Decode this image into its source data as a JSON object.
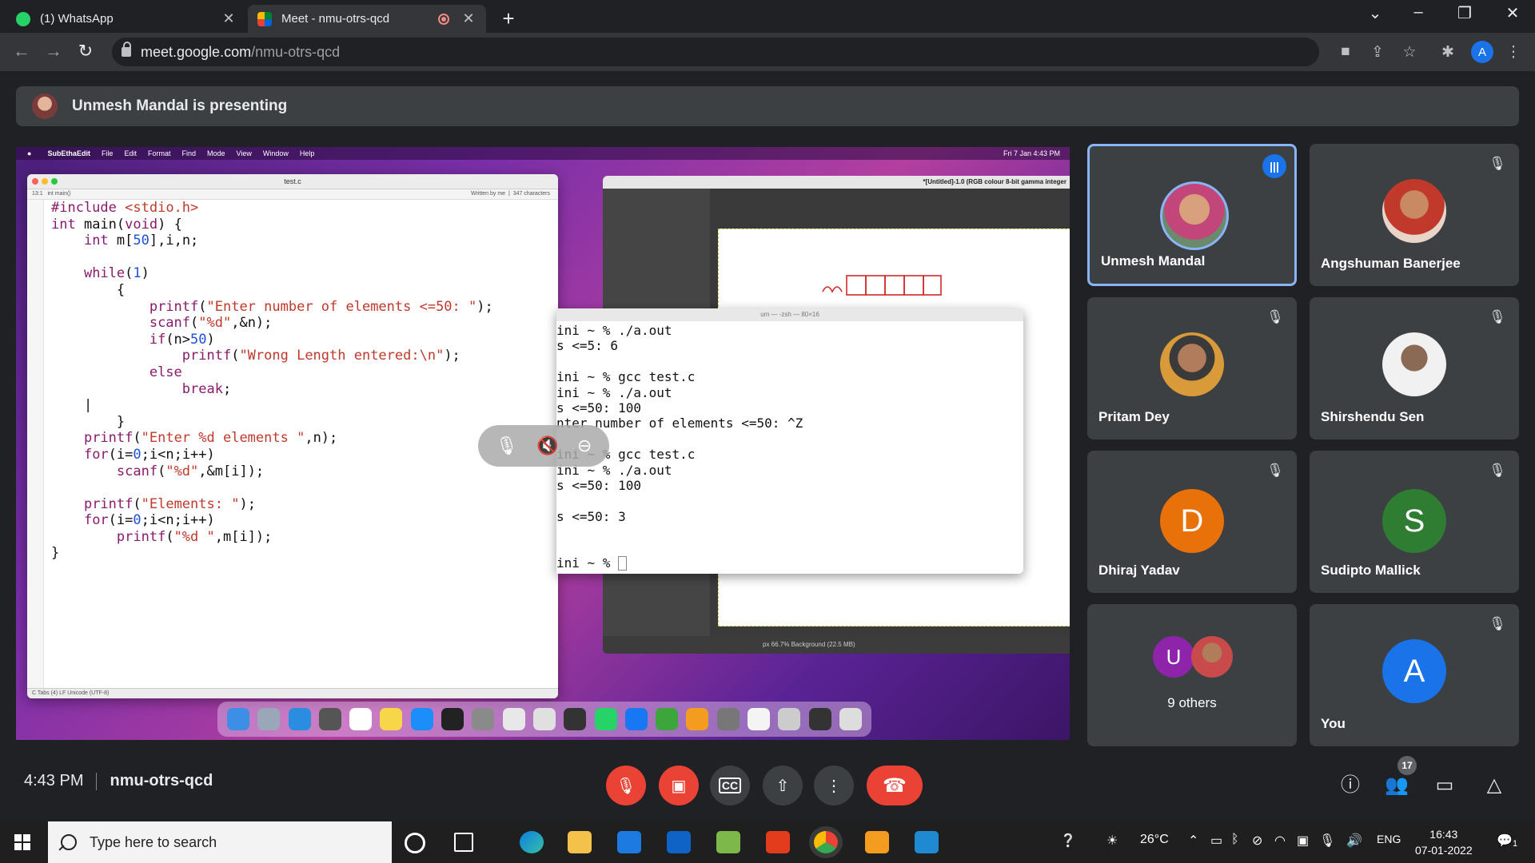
{
  "browser": {
    "tabs": [
      {
        "label": "(1) WhatsApp",
        "icon": "whatsapp-icon"
      },
      {
        "label": "Meet - nmu-otrs-qcd",
        "icon": "meet-icon"
      }
    ],
    "url_host": "meet.google.com",
    "url_path": "/nmu-otrs-qcd",
    "profile_initial": "A"
  },
  "meet": {
    "presenting_text": "Unmesh Mandal is presenting",
    "time": "4:43 PM",
    "meeting_code": "nmu-otrs-qcd",
    "participant_count": "17",
    "participants": [
      {
        "name": "Unmesh Mandal",
        "speaking": true
      },
      {
        "name": "Angshuman Banerjee"
      },
      {
        "name": "Pritam Dey"
      },
      {
        "name": "Shirshendu Sen"
      },
      {
        "name": "Dhiraj Yadav",
        "initial": "D",
        "color": "#e8710a"
      },
      {
        "name": "Sudipto Mallick",
        "initial": "S",
        "color": "#2e7d32"
      },
      {
        "name": "9 others",
        "initial": "U",
        "color": "#8e24aa"
      },
      {
        "name": "You",
        "initial": "A",
        "color": "#1a73e8"
      }
    ]
  },
  "shared_screen": {
    "menubar": {
      "app": "SubEthaEdit",
      "items": [
        "File",
        "Edit",
        "Format",
        "Find",
        "Mode",
        "View",
        "Window",
        "Help"
      ],
      "clock": "Fri 7 Jan 4:43 PM"
    },
    "editor": {
      "filename": "test.c",
      "position": "13:1",
      "function": "int main()",
      "author": "Written by me",
      "chars": "347 characters",
      "status": "C  Tabs (4)  LF  Unicode (UTF-8)"
    },
    "gimp": {
      "title": "*[Untitled]-1.0 (RGB colour 8-bit gamma integer",
      "status": "px  66.7%  Background (22.5 MB)"
    },
    "terminal": {
      "title": "um — -zsh — 80×16",
      "lines": [
        "ini ~ % ./a.out",
        "s <=5: 6",
        "",
        "ini ~ % gcc test.c",
        "ini ~ % ./a.out",
        "s <=50: 100",
        "nter number of elements <=50: ^Z",
        "",
        "ini ~ % gcc test.c",
        "ini ~ % ./a.out",
        "s <=50: 100",
        "",
        "s <=50: 3",
        "",
        "",
        "ini ~ % "
      ]
    }
  },
  "taskbar": {
    "search_placeholder": "Type here to search",
    "weather": "26°C",
    "language": "ENG",
    "time": "16:43",
    "date": "07-01-2022",
    "notifications": "1"
  }
}
